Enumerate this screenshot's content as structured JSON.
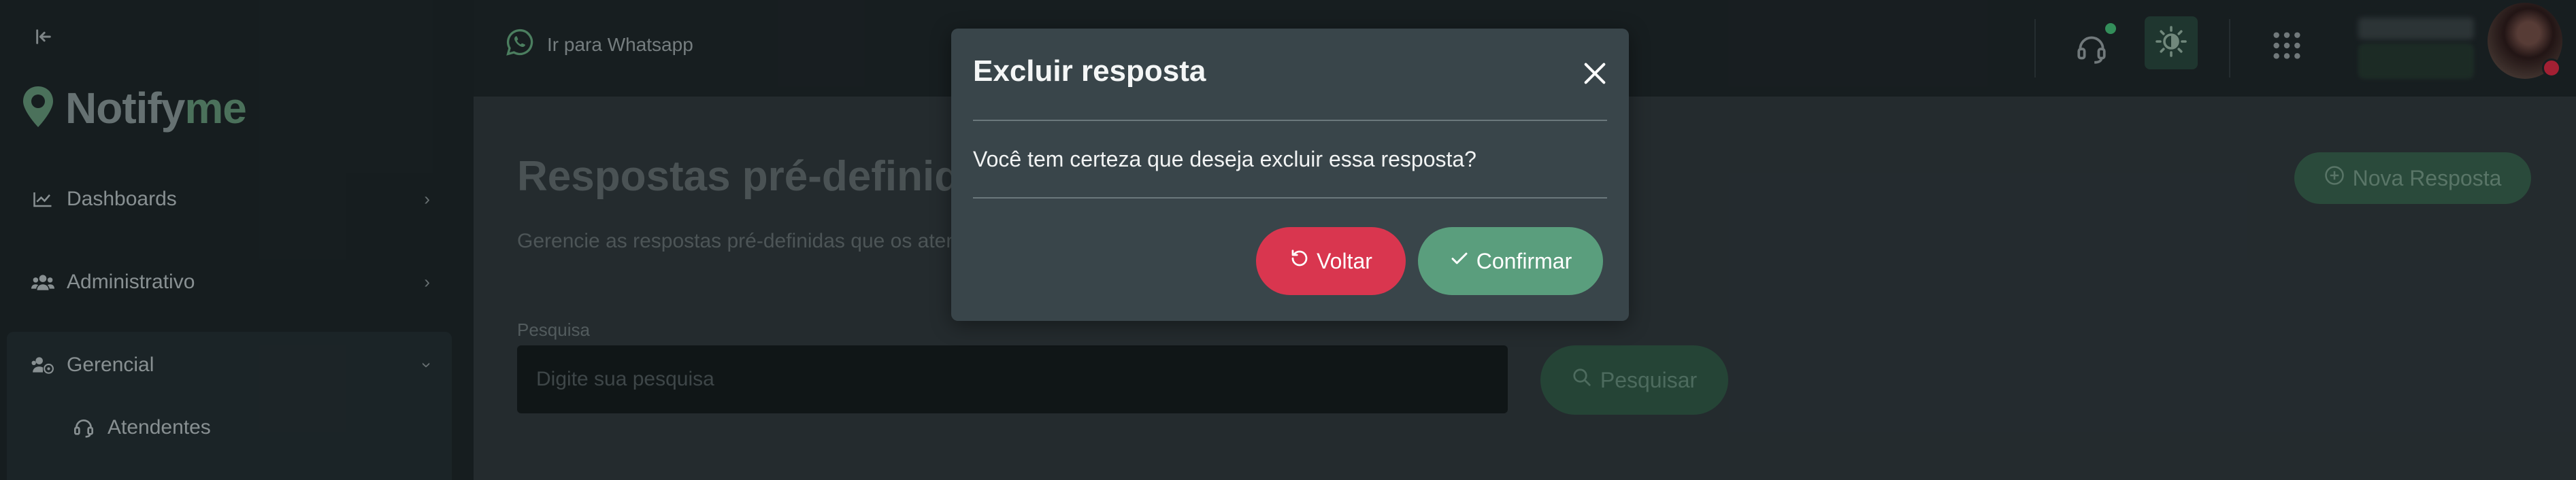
{
  "sidebar": {
    "logo": {
      "part1": "Notify",
      "part2": "me"
    },
    "items": [
      {
        "label": "Dashboards",
        "icon": "chart-line-icon"
      },
      {
        "label": "Administrativo",
        "icon": "users-icon"
      },
      {
        "label": "Gerencial",
        "icon": "users-gear-icon"
      }
    ],
    "subitems": [
      {
        "label": "Atendentes",
        "icon": "headset-icon"
      }
    ]
  },
  "topbar": {
    "whatsapp_link": "Ir para Whatsapp"
  },
  "main": {
    "title": "Respostas pré-definidas",
    "subtitle": "Gerencie as respostas pré-definidas que os atendentes podem utilizar",
    "new_button": "Nova Resposta",
    "search_label": "Pesquisa",
    "search_placeholder": "Digite sua pesquisa",
    "search_button": "Pesquisar"
  },
  "modal": {
    "title": "Excluir resposta",
    "message": "Você tem certeza que deseja excluir essa resposta?",
    "back_button": "Voltar",
    "confirm_button": "Confirmar"
  },
  "colors": {
    "danger": "#d9364f",
    "success": "#5a9e7d",
    "brand": "#5c8a70"
  }
}
